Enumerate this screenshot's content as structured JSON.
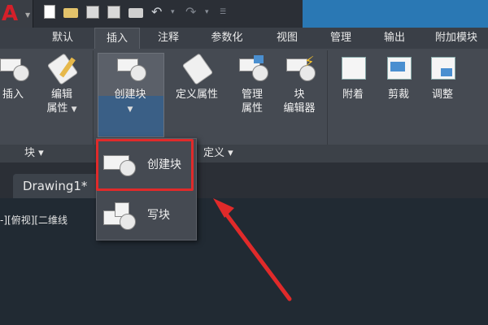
{
  "app": {
    "logo_letter": "A"
  },
  "quick_access": {
    "icons": [
      "new-file-icon",
      "open-folder-icon",
      "save-icon",
      "save-as-icon",
      "print-icon",
      "undo-icon",
      "redo-icon"
    ]
  },
  "tabs": [
    {
      "label": "默认"
    },
    {
      "label": "插入",
      "active": true
    },
    {
      "label": "注释"
    },
    {
      "label": "参数化"
    },
    {
      "label": "视图"
    },
    {
      "label": "管理"
    },
    {
      "label": "输出"
    },
    {
      "label": "附加模块"
    }
  ],
  "ribbon": {
    "insert": "插入",
    "edit_attr_line1": "编辑",
    "edit_attr_line2": "属性",
    "create_block": "创建块",
    "define_attr": "定义属性",
    "manage_attr_line1": "管理",
    "manage_attr_line2": "属性",
    "block_editor_line1": "块",
    "block_editor_line2": "编辑器",
    "attach": "附着",
    "clip": "剪裁",
    "adjust": "调整"
  },
  "groups": {
    "block": "块 ▾",
    "define": "定义 ▾"
  },
  "dropdown": {
    "create_block": "创建块",
    "write_block": "写块"
  },
  "document": {
    "tab_title": "Drawing1*"
  },
  "viewport": {
    "label": "-][俯视][二维线"
  },
  "colors": {
    "highlight": "#e02a2a",
    "arrow": "#e02a2a",
    "title_blue": "#2a78b4"
  }
}
